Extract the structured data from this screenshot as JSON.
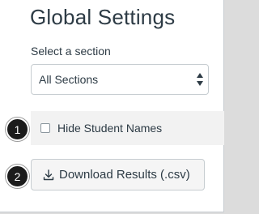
{
  "page": {
    "title": "Global Settings"
  },
  "section_select": {
    "label": "Select a section",
    "selected": "All Sections"
  },
  "hide_names": {
    "label": "Hide Student Names",
    "checked": false
  },
  "download": {
    "label": "Download Results (.csv)",
    "icon": "download-icon"
  },
  "callouts": [
    "1",
    "2"
  ],
  "colors": {
    "text": "#2d3b45",
    "row_background": "#f2f2f2",
    "badge": "#1c1c1c"
  }
}
